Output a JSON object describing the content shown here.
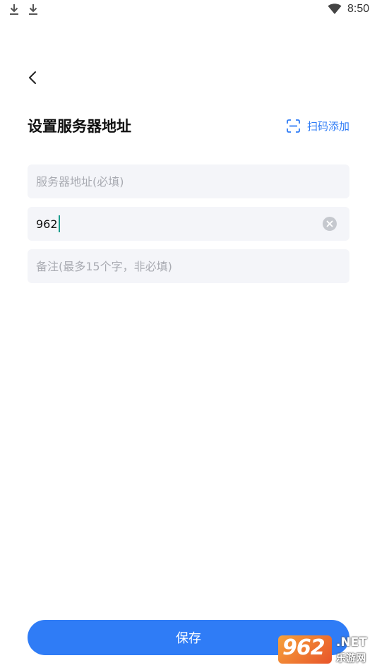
{
  "status_bar": {
    "time": "8:50",
    "notification_icons": [
      "download-icon",
      "download-icon"
    ],
    "wifi_icon": "wifi-icon"
  },
  "header": {
    "back_icon": "chevron-left-icon",
    "title": "设置服务器地址",
    "scan_add_label": "扫码添加",
    "scan_icon": "scan-icon",
    "accent_color": "#2f7cf6"
  },
  "form": {
    "address": {
      "placeholder": "服务器地址(必填)",
      "value": ""
    },
    "port": {
      "value": "962",
      "clear_icon": "clear-icon"
    },
    "note": {
      "placeholder": "备注(最多15个字，非必填)",
      "value": ""
    }
  },
  "footer": {
    "save_label": "保存"
  },
  "watermark": {
    "number": "962",
    "brand": ".NET",
    "subtitle": "乐游网"
  }
}
